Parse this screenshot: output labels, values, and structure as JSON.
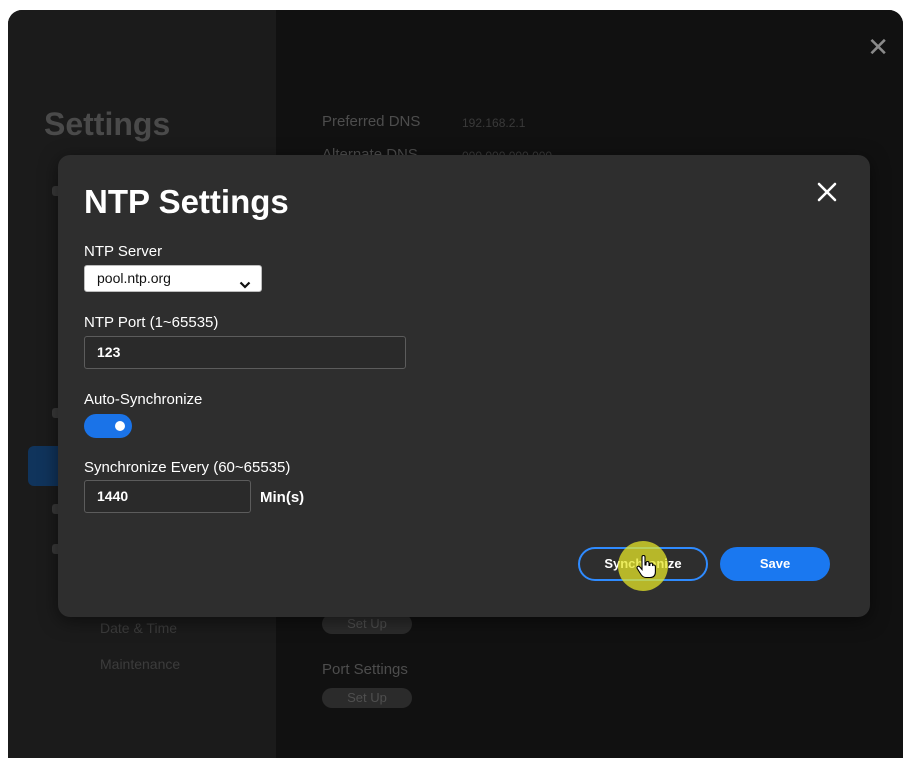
{
  "window": {
    "title": "Settings",
    "sidebar": {
      "items": [
        "Date & Time",
        "Maintenance"
      ]
    },
    "main": {
      "rows": [
        {
          "label": "Preferred DNS",
          "value": "192.168.2.1"
        },
        {
          "label": "Alternate DNS",
          "value": "000.000.000.000"
        }
      ],
      "setup_label": "Set Up",
      "port_settings_label": "Port Settings"
    }
  },
  "modal": {
    "title": "NTP Settings",
    "ntp_server": {
      "label": "NTP Server",
      "selected": "pool.ntp.org"
    },
    "ntp_port": {
      "label": "NTP Port (1~65535)",
      "value": "123"
    },
    "auto_sync": {
      "label": "Auto-Synchronize",
      "enabled": true
    },
    "sync_every": {
      "label": "Synchronize Every (60~65535)",
      "value": "1440",
      "unit": "Min(s)"
    },
    "buttons": {
      "synchronize": "Synchronize",
      "save": "Save"
    }
  },
  "icons": {
    "close": "close-icon",
    "chevron": "chevron-down-icon",
    "cursor": "hand-cursor-icon"
  },
  "colors": {
    "accent": "#1a78f0",
    "modal_bg": "#2e2e2e",
    "toggle_on": "#1a73e8"
  }
}
